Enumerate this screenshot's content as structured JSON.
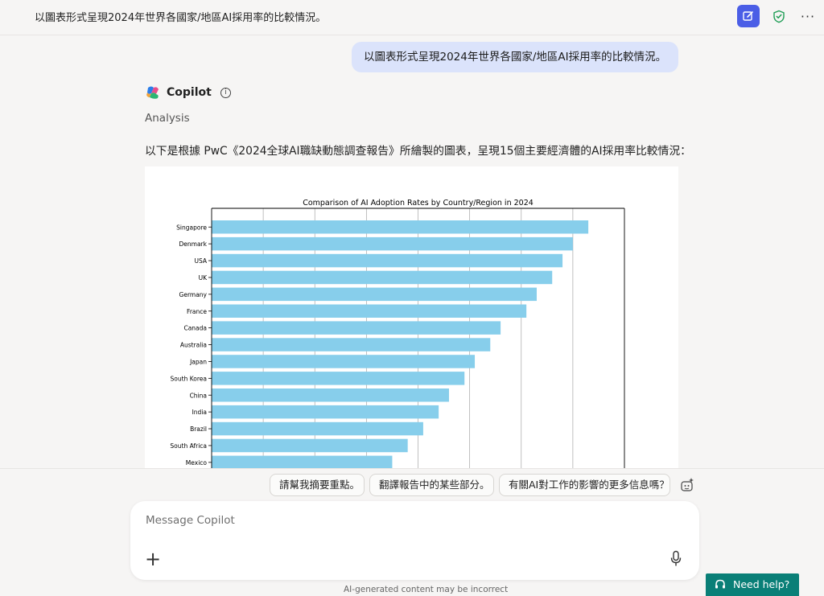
{
  "header": {
    "title": "以圖表形式呈現2024年世界各國家/地區AI採用率的比較情況。",
    "more_label": "···"
  },
  "conversation": {
    "user_message": "以圖表形式呈現2024年世界各國家/地區AI採用率的比較情況。",
    "assistant_name": "Copilot",
    "analysis_label": "Analysis",
    "intro_text": "以下是根據 PwC《2024全球AI職缺動態調查報告》所繪製的圖表，呈現15個主要經濟體的AI採用率比較情況："
  },
  "chart_data": {
    "type": "bar",
    "orientation": "horizontal",
    "title": "Comparison of AI Adoption Rates by Country/Region in 2024",
    "categories": [
      "Singapore",
      "Denmark",
      "USA",
      "UK",
      "Germany",
      "France",
      "Canada",
      "Australia",
      "Japan",
      "South Korea",
      "China",
      "India",
      "Brazil",
      "South Africa",
      "Mexico"
    ],
    "values": [
      36.5,
      35,
      34,
      33,
      31.5,
      30.5,
      28,
      27,
      25.5,
      24.5,
      23,
      22,
      20.5,
      19,
      17.5
    ],
    "xlim": [
      0,
      40
    ],
    "grid": "x",
    "bar_color": "#87ceeb"
  },
  "suggestions": [
    "請幫我摘要重點。",
    "翻譯報告中的某些部分。",
    "有關AI對工作的影響的更多信息嗎？"
  ],
  "composer": {
    "placeholder": "Message Copilot",
    "plus_label": "+"
  },
  "footer": {
    "disclaimer": "AI-generated content may be incorrect",
    "help_label": "Need help?"
  },
  "colors": {
    "accent": "#4b5ee6",
    "user_bubble": "#dbe3fb",
    "help_bg": "#0a7f77",
    "shield": "#1f9d55"
  },
  "icons": [
    "new-chat-icon",
    "shield-check-icon",
    "more-icon",
    "copilot-logo-icon",
    "info-icon",
    "sparkle-icon",
    "plus-icon",
    "microphone-icon",
    "headset-icon"
  ]
}
